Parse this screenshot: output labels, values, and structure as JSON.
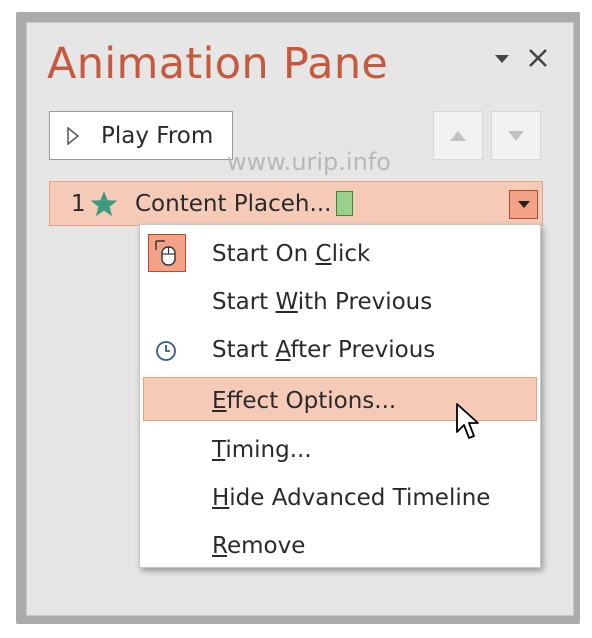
{
  "pane": {
    "title": "Animation Pane",
    "play_button_label": "Play From",
    "options_icon": "triangle-down-icon",
    "close_icon": "close-icon"
  },
  "watermark": "www.urip.info",
  "animation_item": {
    "number": "1",
    "effect_icon": "star-icon",
    "name": "Content Placeh..."
  },
  "menu": {
    "items": [
      {
        "pre": "Start On ",
        "ul": "C",
        "post": "lick",
        "icon": "mouse-click-icon"
      },
      {
        "pre": "Start ",
        "ul": "W",
        "post": "ith Previous",
        "icon": ""
      },
      {
        "pre": "Start ",
        "ul": "A",
        "post": "fter Previous",
        "icon": "clock-icon"
      },
      {
        "pre": "",
        "ul": "E",
        "post": "ffect Options...",
        "icon": ""
      },
      {
        "pre": "",
        "ul": "T",
        "post": "iming...",
        "icon": ""
      },
      {
        "pre": "",
        "ul": "H",
        "post": "ide Advanced Timeline",
        "icon": ""
      },
      {
        "pre": "",
        "ul": "R",
        "post": "emove",
        "icon": ""
      }
    ]
  },
  "colors": {
    "accent": "#c55a3f",
    "selection": "#f5cbb8",
    "selection_border": "#e8a386",
    "timing_bar": "#9bd08c",
    "star": "#3e9a7e"
  }
}
